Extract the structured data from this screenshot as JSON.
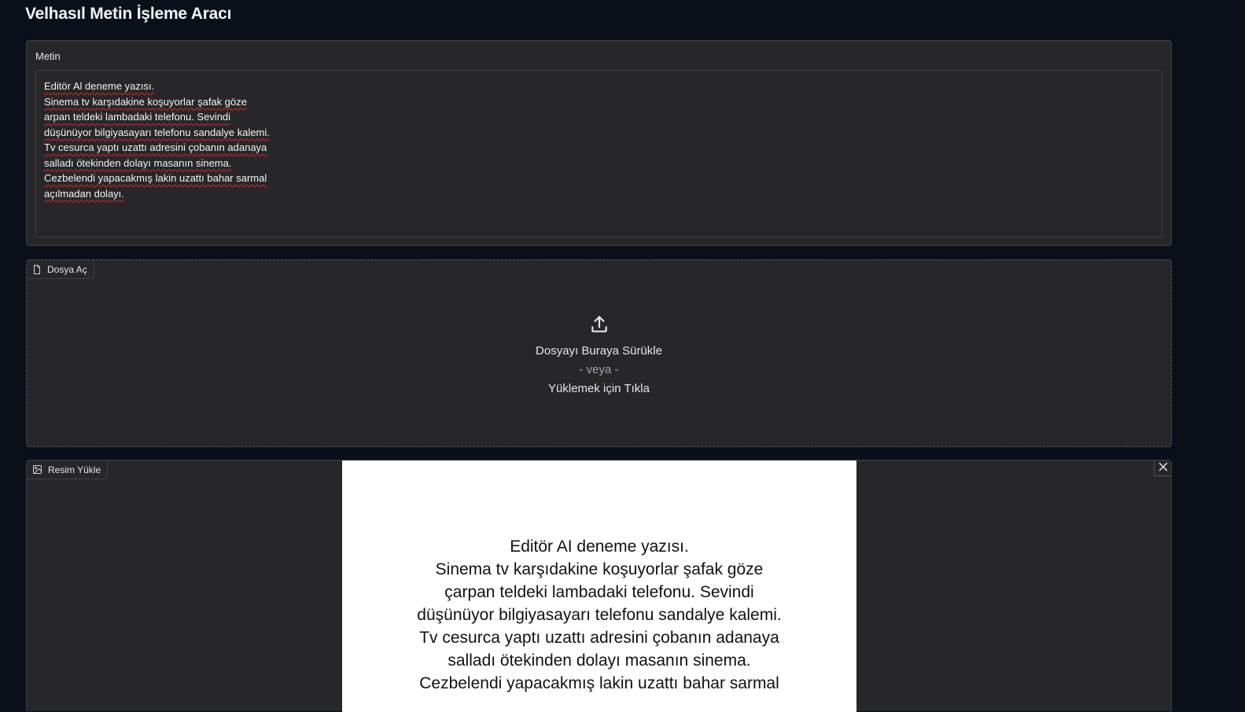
{
  "app": {
    "title": "Velhasıl Metin İşleme Aracı"
  },
  "text_panel": {
    "label": "Metin",
    "lines": [
      "Editör Al deneme yazısı.",
      "Sinema tv karşıdakine koşuyorlar şafak göze",
      "arpan teldeki lambadaki telefonu. Sevindi",
      "düşünüyor bilgiyasayarı telefonu sandalye kalemi.",
      "Tv cesurca yaptı uzattı adresini çobanın adanaya",
      "salladı ötekinden dolayı masanın sinema.",
      "Cezbelendi yapacakmış lakin uzattı bahar sarmal",
      "açılmadan dolayı."
    ]
  },
  "file_upload": {
    "label": "Dosya Aç",
    "icon": "file-icon",
    "drop_text": "Dosyayı Buraya Sürükle",
    "or_text": "- veya -",
    "click_text": "Yüklemek için Tıkla",
    "upload_icon": "upload-icon"
  },
  "image_upload": {
    "label": "Resim Yükle",
    "icon": "image-icon",
    "close_icon": "close-icon",
    "preview_lines": [
      "Editör AI deneme yazısı.",
      "Sinema tv karşıdakine koşuyorlar şafak göze",
      "çarpan teldeki lambadaki telefonu. Sevindi",
      "düşünüyor bilgiyasayarı telefonu sandalye kalemi.",
      "Tv cesurca yaptı uzattı adresini çobanın adanaya",
      "salladı ötekinden dolayı masanın sinema.",
      "Cezbelendi yapacakmış lakin uzattı bahar sarmal"
    ]
  },
  "colors": {
    "background": "#0b0f19",
    "panel": "#27272a",
    "border": "#3f3f46",
    "spellcheck_underline": "#dc2626"
  }
}
